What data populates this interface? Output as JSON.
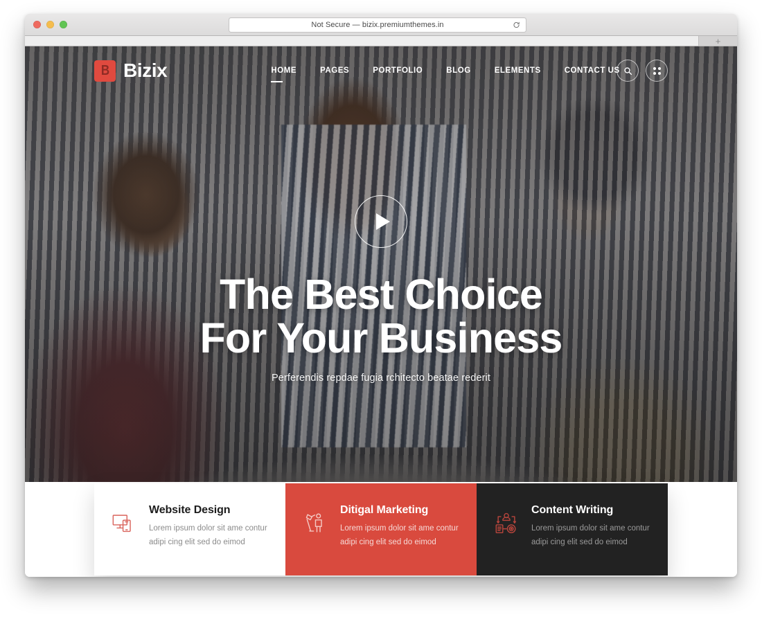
{
  "browser": {
    "url_text": "Not Secure — bizix.premiumthemes.in",
    "reload_label": "Reload",
    "new_tab_label": "+",
    "traffic_lights": [
      "close",
      "minimize",
      "maximize"
    ]
  },
  "site": {
    "brand": {
      "mark_glyph": "B",
      "name": "Bizix"
    },
    "nav": [
      {
        "label": "HOME",
        "active": true
      },
      {
        "label": "PAGES",
        "active": false
      },
      {
        "label": "PORTFOLIO",
        "active": false
      },
      {
        "label": "BLOG",
        "active": false
      },
      {
        "label": "ELEMENTS",
        "active": false
      },
      {
        "label": "CONTACT US",
        "active": false
      }
    ],
    "header_actions": [
      {
        "icon": "search-icon"
      },
      {
        "icon": "grid-dots-icon"
      }
    ]
  },
  "hero": {
    "play_button_label": "Play video",
    "title_line_1": "The Best Choice",
    "title_line_2": "For Your Business",
    "subtitle": "Perferendis repdae fugia rchitecto beatae rederit"
  },
  "services": [
    {
      "id": "website-design",
      "icon": "monitor-mobile-icon",
      "title": "Website Design",
      "text_line_1": "Lorem ipsum dolor sit ame contur",
      "text_line_2": "adipi cing elit sed do eimod",
      "background": "#ffffff",
      "title_color": "#1d1d1d",
      "text_color": "#8b8b8b",
      "icon_color": "#d9645c"
    },
    {
      "id": "digital-marketing",
      "icon": "megaphone-person-icon",
      "title": "Ditigal Marketing",
      "text_line_1": "Lorem ipsum dolor sit ame contur",
      "text_line_2": "adipi cing elit sed do eimod",
      "background": "#d94a3e",
      "title_color": "#ffffff",
      "text_color": "#f6d9d6",
      "icon_color": "#f4c9c4"
    },
    {
      "id": "content-writing",
      "icon": "workflow-target-icon",
      "title": "Content Writing",
      "text_line_1": "Lorem ipsum dolor sit ame contur",
      "text_line_2": "adipi cing elit sed do eimod",
      "background": "#222222",
      "title_color": "#ffffff",
      "text_color": "#9a9a9a",
      "icon_color": "#b8453c"
    }
  ],
  "theme": {
    "accent_red": "#d94a3e",
    "brand_red": "#e04a3f",
    "dark": "#222222",
    "white": "#ffffff"
  }
}
